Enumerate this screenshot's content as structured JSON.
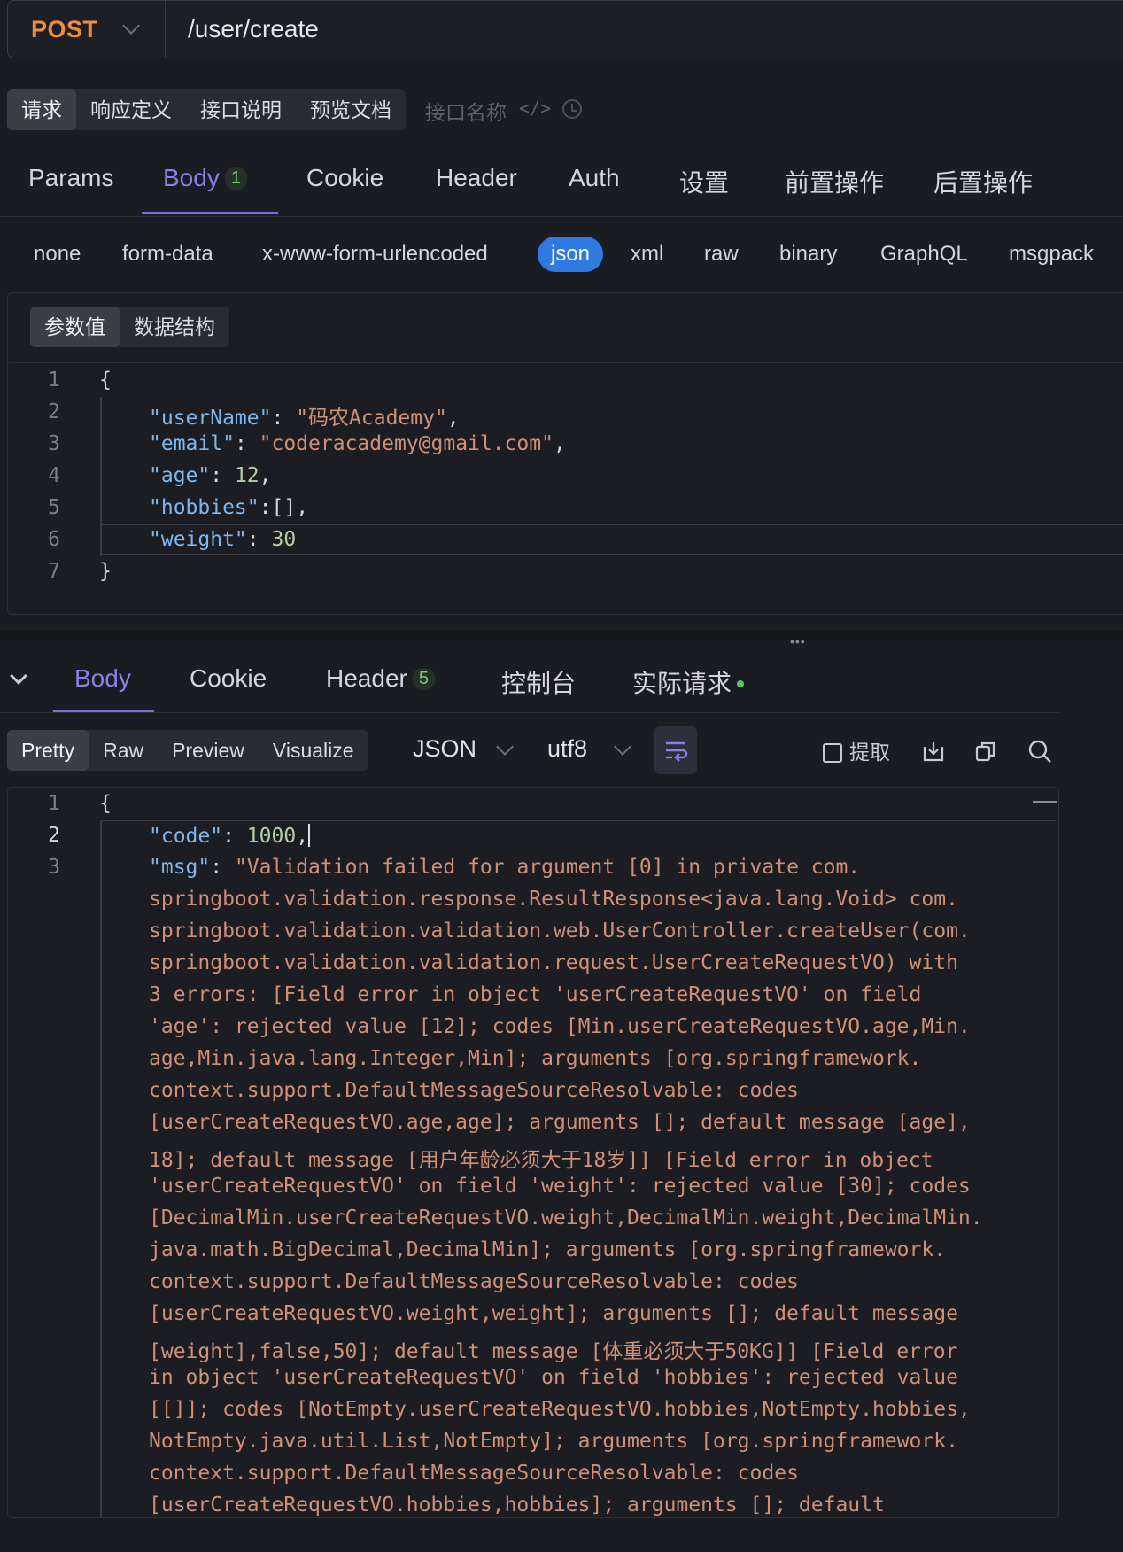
{
  "url_bar": {
    "method": "POST",
    "path": "/user/create"
  },
  "top_tabs": [
    "请求",
    "响应定义",
    "接口说明",
    "预览文档"
  ],
  "api_name_placeholder": "接口名称",
  "request_tabs": {
    "params": "Params",
    "body": "Body",
    "body_count": "1",
    "cookie": "Cookie",
    "header": "Header",
    "auth": "Auth",
    "settings": "设置",
    "pre": "前置操作",
    "post": "后置操作"
  },
  "body_types": [
    "none",
    "form-data",
    "x-www-form-urlencoded",
    "json",
    "xml",
    "raw",
    "binary",
    "GraphQL",
    "msgpack"
  ],
  "body_view_tabs": [
    "参数值",
    "数据结构"
  ],
  "request_code": {
    "line_numbers": [
      "1",
      "2",
      "3",
      "4",
      "5",
      "6",
      "7"
    ],
    "open_brace": "{",
    "close_brace": "}",
    "k_userName": "\"userName\"",
    "v_userName": "\"码农Academy\"",
    "k_email": "\"email\"",
    "v_email": "\"coderacademy@gmail.com\"",
    "k_age": "\"age\"",
    "v_age": "12",
    "k_hobbies": "\"hobbies\"",
    "v_hobbies": "[]",
    "k_weight": "\"weight\"",
    "v_weight": "30"
  },
  "response_tabs": {
    "body": "Body",
    "cookie": "Cookie",
    "header": "Header",
    "header_count": "5",
    "console": "控制台",
    "actual": "实际请求"
  },
  "format_tabs": [
    "Pretty",
    "Raw",
    "Preview",
    "Visualize"
  ],
  "format_select": "JSON",
  "encoding_select": "utf8",
  "extract_label": "提取",
  "response_code": {
    "line_numbers": [
      "1",
      "2",
      "3"
    ],
    "open_brace": "{",
    "k_code": "\"code\"",
    "v_code": "1000",
    "k_msg": "\"msg\"",
    "msg_lines": [
      "\"Validation failed for argument [0] in private com.",
      "springboot.validation.response.ResultResponse<java.lang.Void> com.",
      "springboot.validation.validation.web.UserController.createUser(com.",
      "springboot.validation.validation.request.UserCreateRequestVO) with",
      "3 errors: [Field error in object 'userCreateRequestVO' on field",
      "'age': rejected value [12]; codes [Min.userCreateRequestVO.age,Min.",
      "age,Min.java.lang.Integer,Min]; arguments [org.springframework.",
      "context.support.DefaultMessageSourceResolvable: codes",
      "[userCreateRequestVO.age,age]; arguments []; default message [age],",
      "18]; default message [用户年龄必须大于18岁]] [Field error in object",
      "'userCreateRequestVO' on field 'weight': rejected value [30]; codes",
      "[DecimalMin.userCreateRequestVO.weight,DecimalMin.weight,DecimalMin.",
      "java.math.BigDecimal,DecimalMin]; arguments [org.springframework.",
      "context.support.DefaultMessageSourceResolvable: codes",
      "[userCreateRequestVO.weight,weight]; arguments []; default message",
      "[weight],false,50]; default message [体重必须大于50KG]] [Field error",
      "in object 'userCreateRequestVO' on field 'hobbies': rejected value",
      "[[]]; codes [NotEmpty.userCreateRequestVO.hobbies,NotEmpty.hobbies,",
      "NotEmpty.java.util.List,NotEmpty]; arguments [org.springframework.",
      "context.support.DefaultMessageSourceResolvable: codes",
      "[userCreateRequestVO.hobbies,hobbies]; arguments []; default"
    ]
  }
}
